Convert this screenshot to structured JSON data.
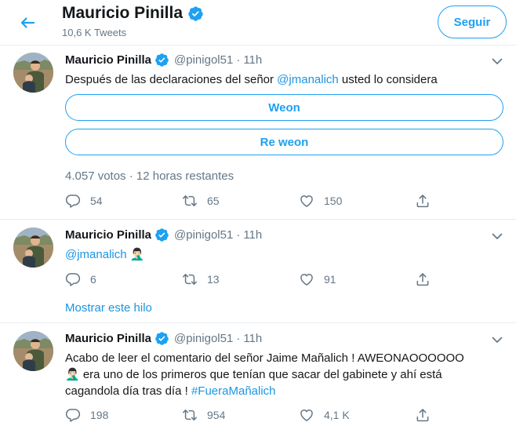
{
  "header": {
    "name": "Mauricio Pinilla",
    "tweet_count": "10,6 K Tweets",
    "follow_label": "Seguir"
  },
  "tweets": [
    {
      "name": "Mauricio Pinilla",
      "handle": "@pinigol51",
      "sep": "·",
      "time": "11h",
      "text_before": "Después de las declaraciones del señor ",
      "mention": "@jmanalich",
      "text_after": " usted lo considera",
      "poll": {
        "options": [
          "Weon",
          "Re weon"
        ],
        "meta": "4.057 votos · 12 horas restantes"
      },
      "reply_count": "54",
      "retweet_count": "65",
      "like_count": "150"
    },
    {
      "name": "Mauricio Pinilla",
      "handle": "@pinigol51",
      "sep": "·",
      "time": "11h",
      "mention": "@jmanalich",
      "emoji": "🤦🏻‍♂️",
      "reply_count": "6",
      "retweet_count": "13",
      "like_count": "91",
      "show_thread": "Mostrar este hilo"
    },
    {
      "name": "Mauricio Pinilla",
      "handle": "@pinigol51",
      "sep": "·",
      "time": "11h",
      "line1": "Acabo de leer el comentario del señor Jaime Mañalich ! AWEONAOOOOOO",
      "line2": "🤦🏻‍♂️ era uno de los primeros que tenían que sacar del gabinete y ahí está",
      "line3_before": "cagandola día tras día ! ",
      "hashtag": "#FueraMañalich",
      "reply_count": "198",
      "retweet_count": "954",
      "like_count": "4,1 K"
    }
  ],
  "colors": {
    "accent": "#1da1f2",
    "link": "#1b95e0",
    "muted": "#657786",
    "text": "#14171a",
    "border": "#e6ecf0"
  },
  "icons": [
    "back-arrow-icon",
    "verified-badge-icon",
    "chevron-down-icon",
    "reply-icon",
    "retweet-icon",
    "like-icon",
    "share-icon",
    "avatar-photo"
  ]
}
